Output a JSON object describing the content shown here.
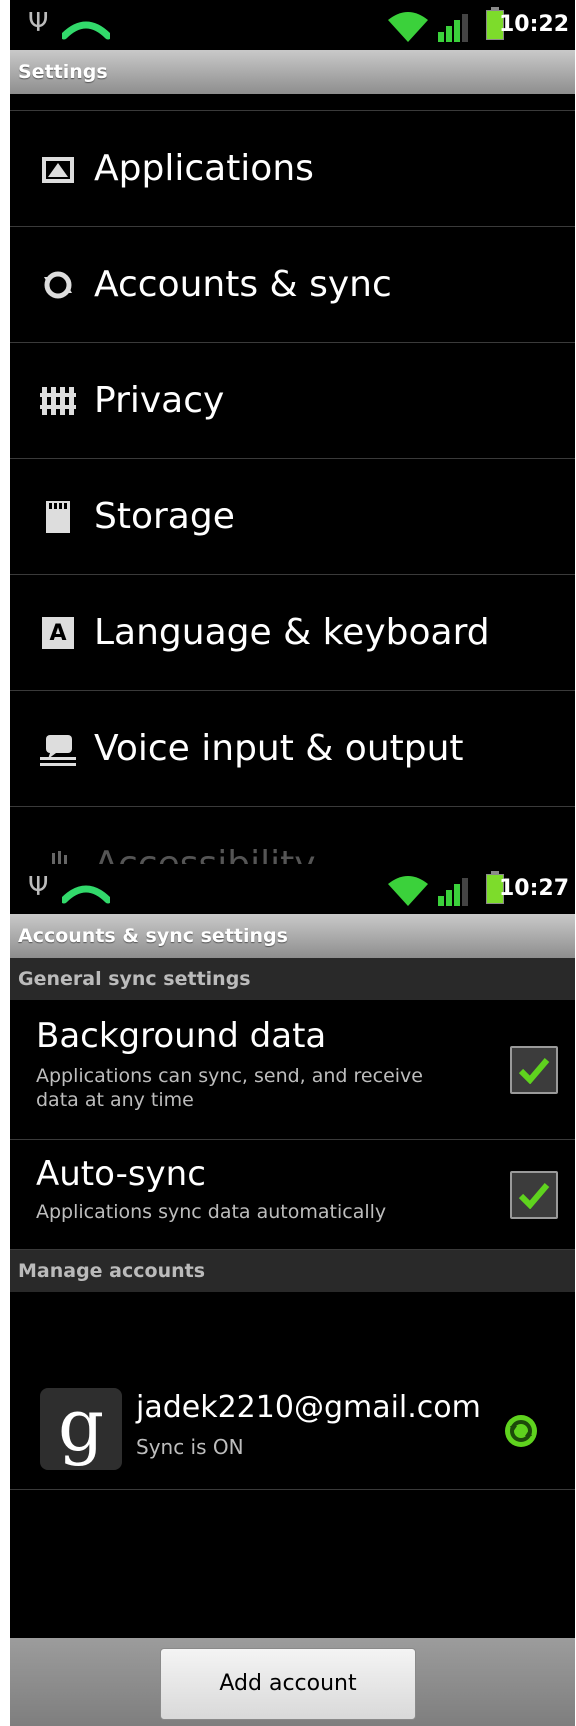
{
  "screen1": {
    "status": {
      "time": "10:22",
      "usb_icon": "usb-icon",
      "call_icon": "call-icon",
      "wifi_icon": "wifi-icon",
      "signal_icon": "signal-icon",
      "battery_icon": "battery-charging-icon"
    },
    "title": "Settings",
    "items": [
      {
        "label": "Applications",
        "icon": "applications-icon"
      },
      {
        "label": "Accounts & sync",
        "icon": "sync-icon"
      },
      {
        "label": "Privacy",
        "icon": "privacy-icon"
      },
      {
        "label": "Storage",
        "icon": "sd-card-icon"
      },
      {
        "label": "Language & keyboard",
        "icon": "keyboard-icon"
      },
      {
        "label": "Voice input & output",
        "icon": "voice-icon"
      },
      {
        "label": "Accessibility",
        "icon": "accessibility-icon"
      }
    ]
  },
  "screen2": {
    "status": {
      "time": "10:27"
    },
    "title": "Accounts & sync settings",
    "general_header": "General sync settings",
    "background_data": {
      "title": "Background data",
      "summary": "Applications can sync, send, and receive data at any time",
      "checked": true
    },
    "auto_sync": {
      "title": "Auto-sync",
      "summary": "Applications sync data automatically",
      "checked": true
    },
    "manage_header": "Manage accounts",
    "account": {
      "email": "jadek2210@gmail.com",
      "status": "Sync is ON",
      "icon": "google-icon"
    },
    "add_account": "Add account"
  },
  "colors": {
    "accent_green": "#7ddc2b",
    "checkmark": "#5fd31e",
    "title_bar": "#a9a9a9"
  }
}
